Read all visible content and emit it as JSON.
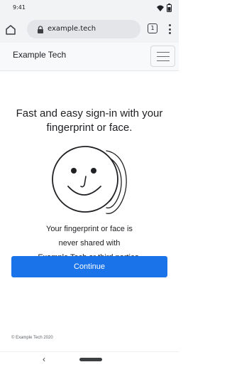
{
  "status_bar": {
    "time": "9:41"
  },
  "browser": {
    "url": "example.tech",
    "tab_count": "1"
  },
  "site": {
    "brand": "Example Tech"
  },
  "main": {
    "headline": "Fast and easy sign-in with your fingerprint or face.",
    "description_lines": [
      "Your fingerprint or face is",
      "never shared with",
      "Example Tech or third parties."
    ],
    "continue_label": "Continue"
  },
  "footer": {
    "copyright": "© Example Tech 2020"
  },
  "nav": {
    "back_glyph": "‹"
  },
  "colors": {
    "accent": "#1a73e8"
  },
  "icons": [
    "signal-icon",
    "battery-icon",
    "home-icon",
    "lock-icon",
    "tabs-icon",
    "menu-icon",
    "hamburger-icon",
    "face-fingerprint-illustration",
    "back-icon"
  ]
}
